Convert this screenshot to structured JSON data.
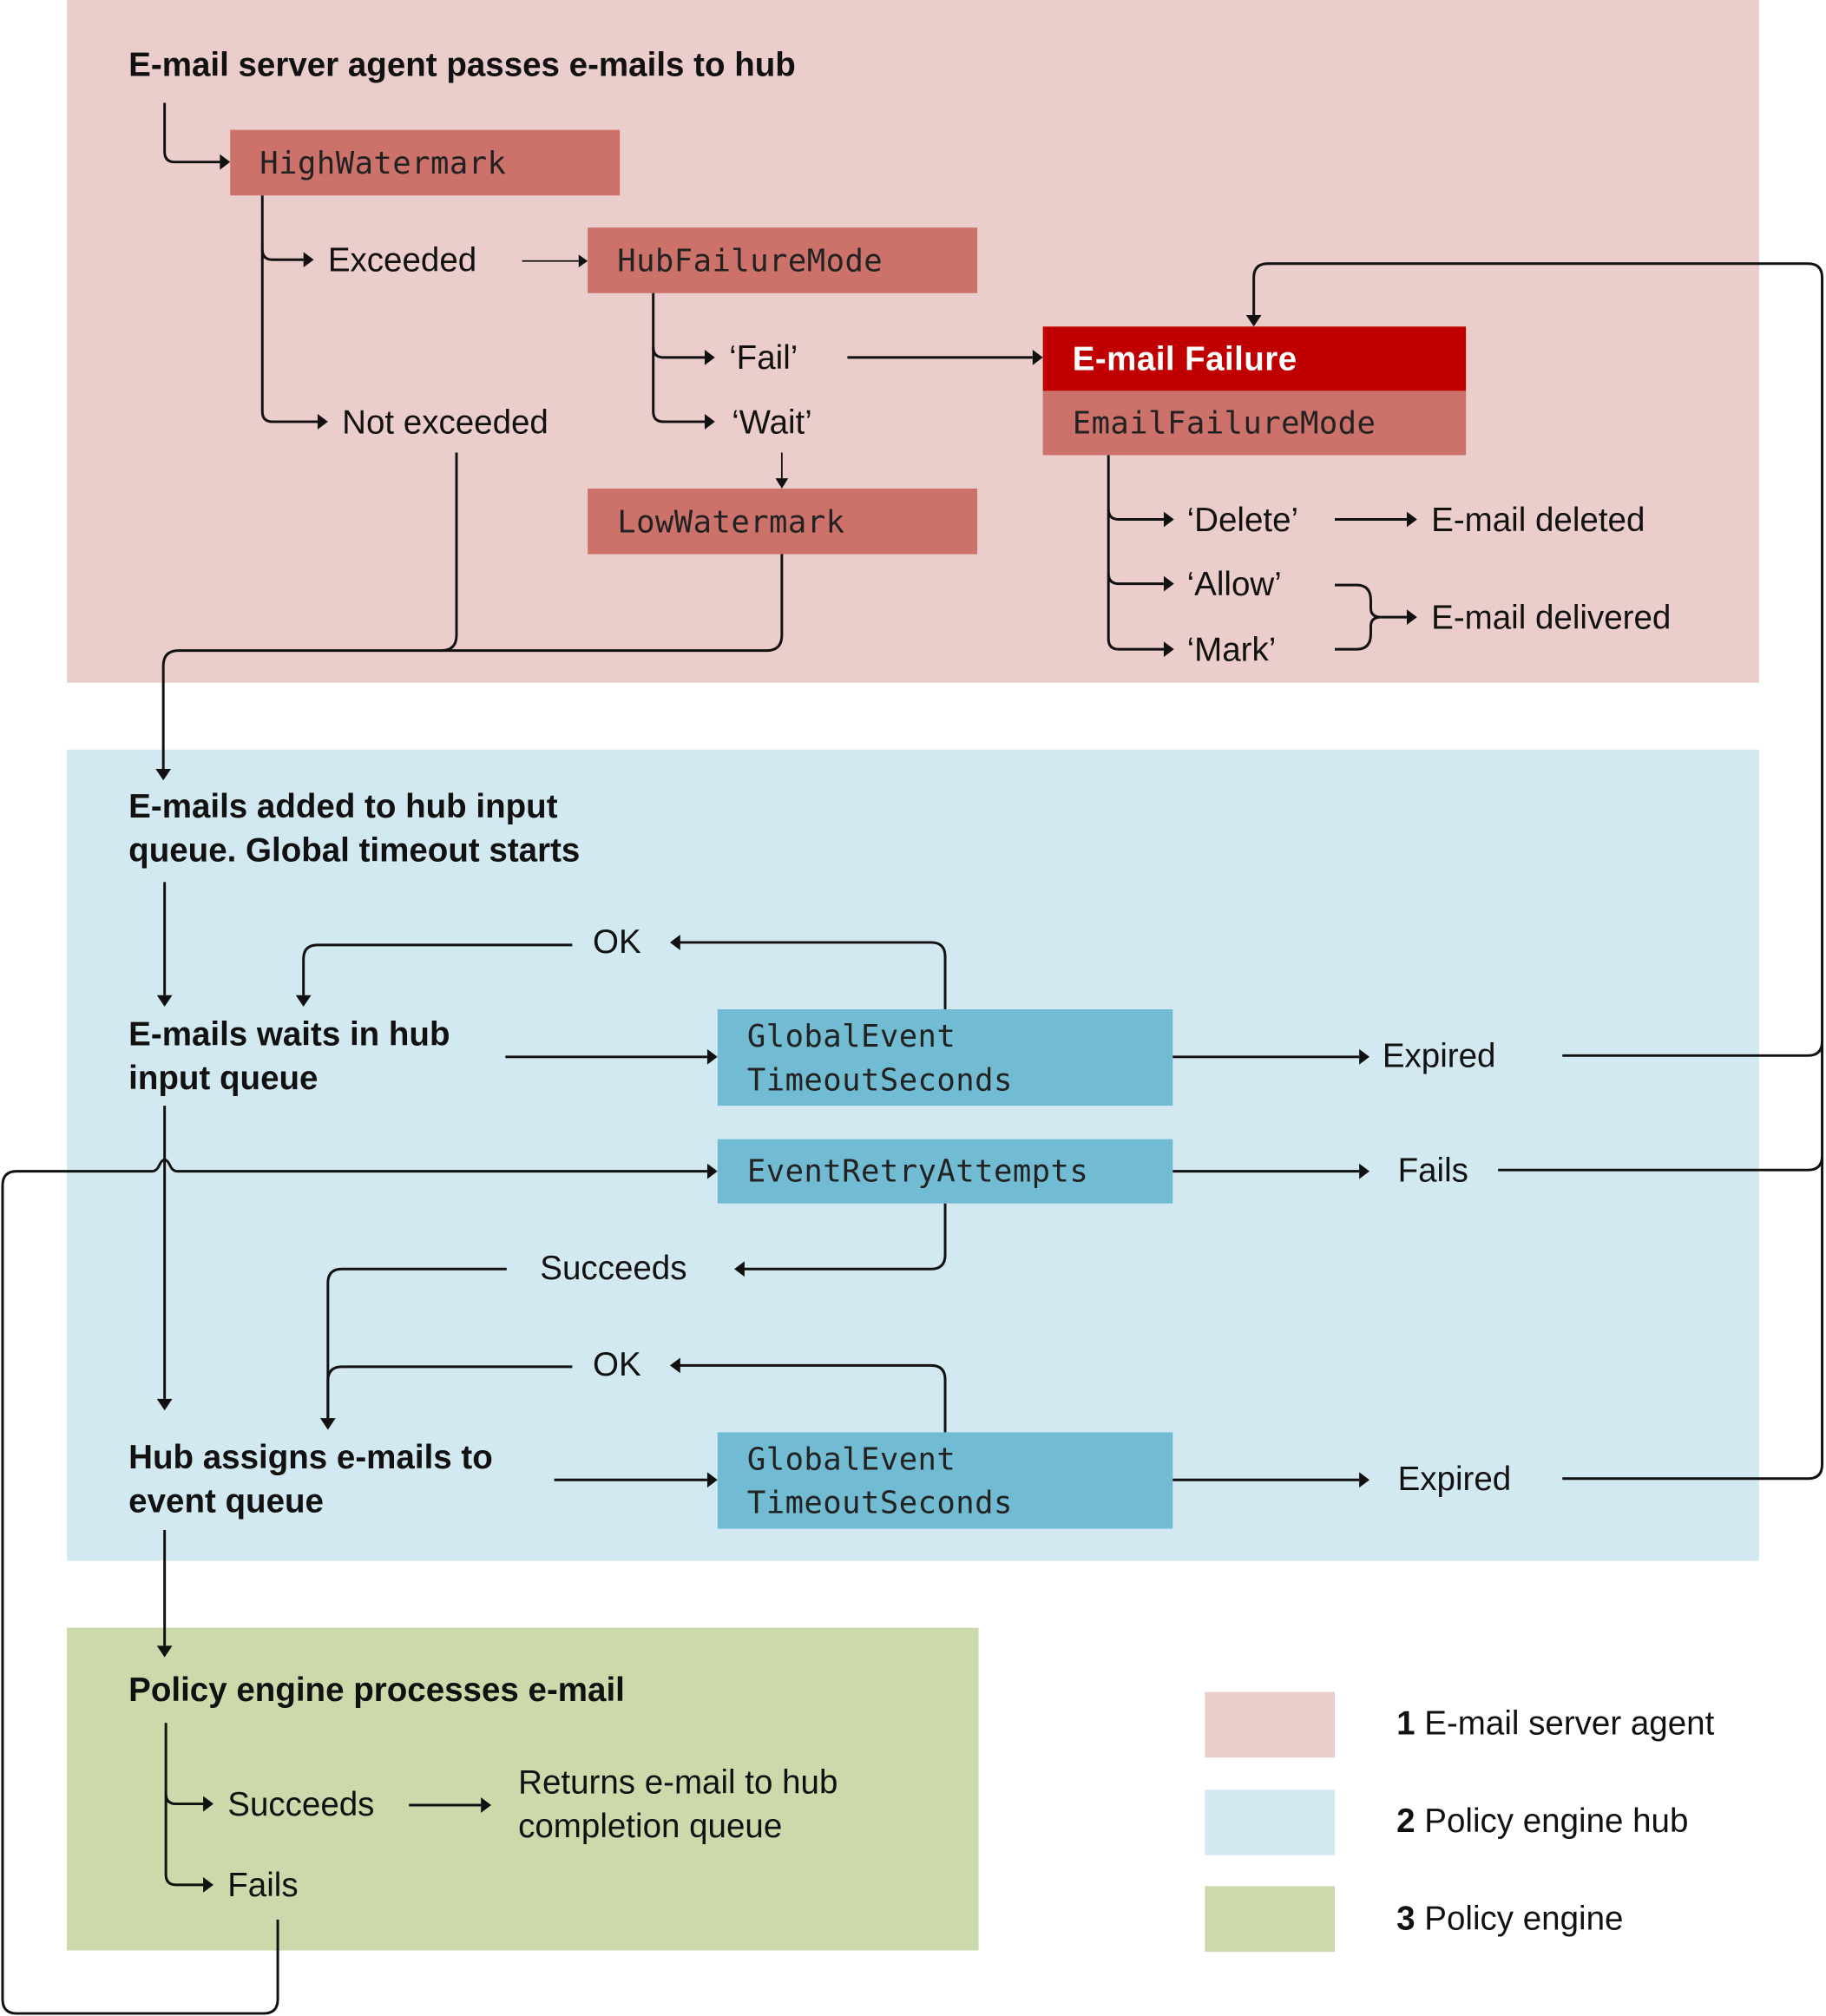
{
  "regions": {
    "agent": {
      "number": "1",
      "label": "E-mail server agent",
      "color": "#ebcdcb"
    },
    "hub": {
      "number": "2",
      "label": "Policy engine hub",
      "color": "#d3e9f1"
    },
    "engine": {
      "number": "3",
      "label": "Policy engine",
      "color": "#cbd9ab"
    }
  },
  "agent_section": {
    "title": "E-mail server agent passes e-mails to hub",
    "high_watermark": "HighWatermark",
    "exceeded": "Exceeded",
    "not_exceeded": "Not exceeded",
    "hub_failure_mode": "HubFailureMode",
    "fail": "‘Fail’",
    "wait": "‘Wait’",
    "low_watermark": "LowWatermark",
    "email_failure_title": "E-mail Failure",
    "email_failure_mode": "EmailFailureMode",
    "delete": "‘Delete’",
    "allow": "‘Allow’",
    "mark": "‘Mark’",
    "email_deleted": "E-mail deleted",
    "email_delivered": "E-mail delivered"
  },
  "hub_section": {
    "added_line1": "E-mails added to hub input",
    "added_line2": "queue. Global timeout starts",
    "waits_line1": "E-mails waits in hub",
    "waits_line2": "input queue",
    "ok_top": "OK",
    "global_timeout_1_line1": "GlobalEvent",
    "global_timeout_1_line2": "TimeoutSeconds",
    "expired_top": "Expired",
    "event_retry": "EventRetryAttempts",
    "fails": "Fails",
    "succeeds": "Succeeds",
    "ok_bottom": "OK",
    "assigns_line1": "Hub assigns e-mails to",
    "assigns_line2": "event queue",
    "global_timeout_2_line1": "GlobalEvent",
    "global_timeout_2_line2": "TimeoutSeconds",
    "expired_bottom": "Expired"
  },
  "engine_section": {
    "title": "Policy engine processes e-mail",
    "succeeds": "Succeeds",
    "returns_line1": "Returns e-mail to hub",
    "returns_line2": "completion queue",
    "fails": "Fails"
  }
}
